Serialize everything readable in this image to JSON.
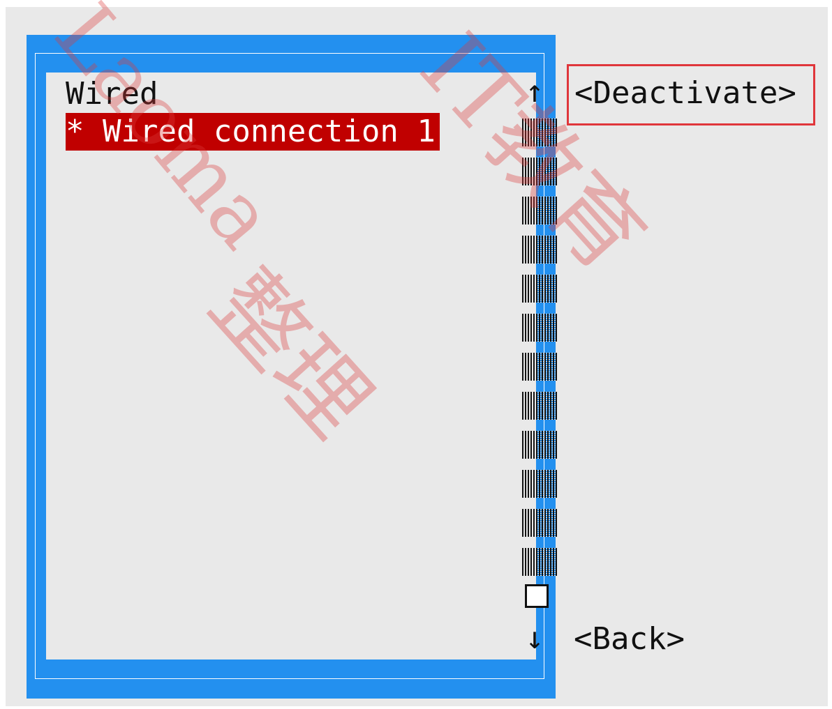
{
  "list": {
    "group_label": "Wired",
    "items": [
      {
        "label": "* Wired connection 1",
        "selected": true
      }
    ]
  },
  "scrollbar": {
    "up_glyph": "↑",
    "down_glyph": "↓",
    "track_blocks": 12
  },
  "buttons": {
    "deactivate": "<Deactivate>",
    "back": "<Back>"
  },
  "watermark": {
    "line1": "Laoma",
    "line2": "整理",
    "line3": "IT教育"
  },
  "colors": {
    "frame_blue": "#2390ef",
    "selection_red": "#c00000",
    "highlight_box": "#e0363b",
    "background": "#e9e9e9"
  }
}
